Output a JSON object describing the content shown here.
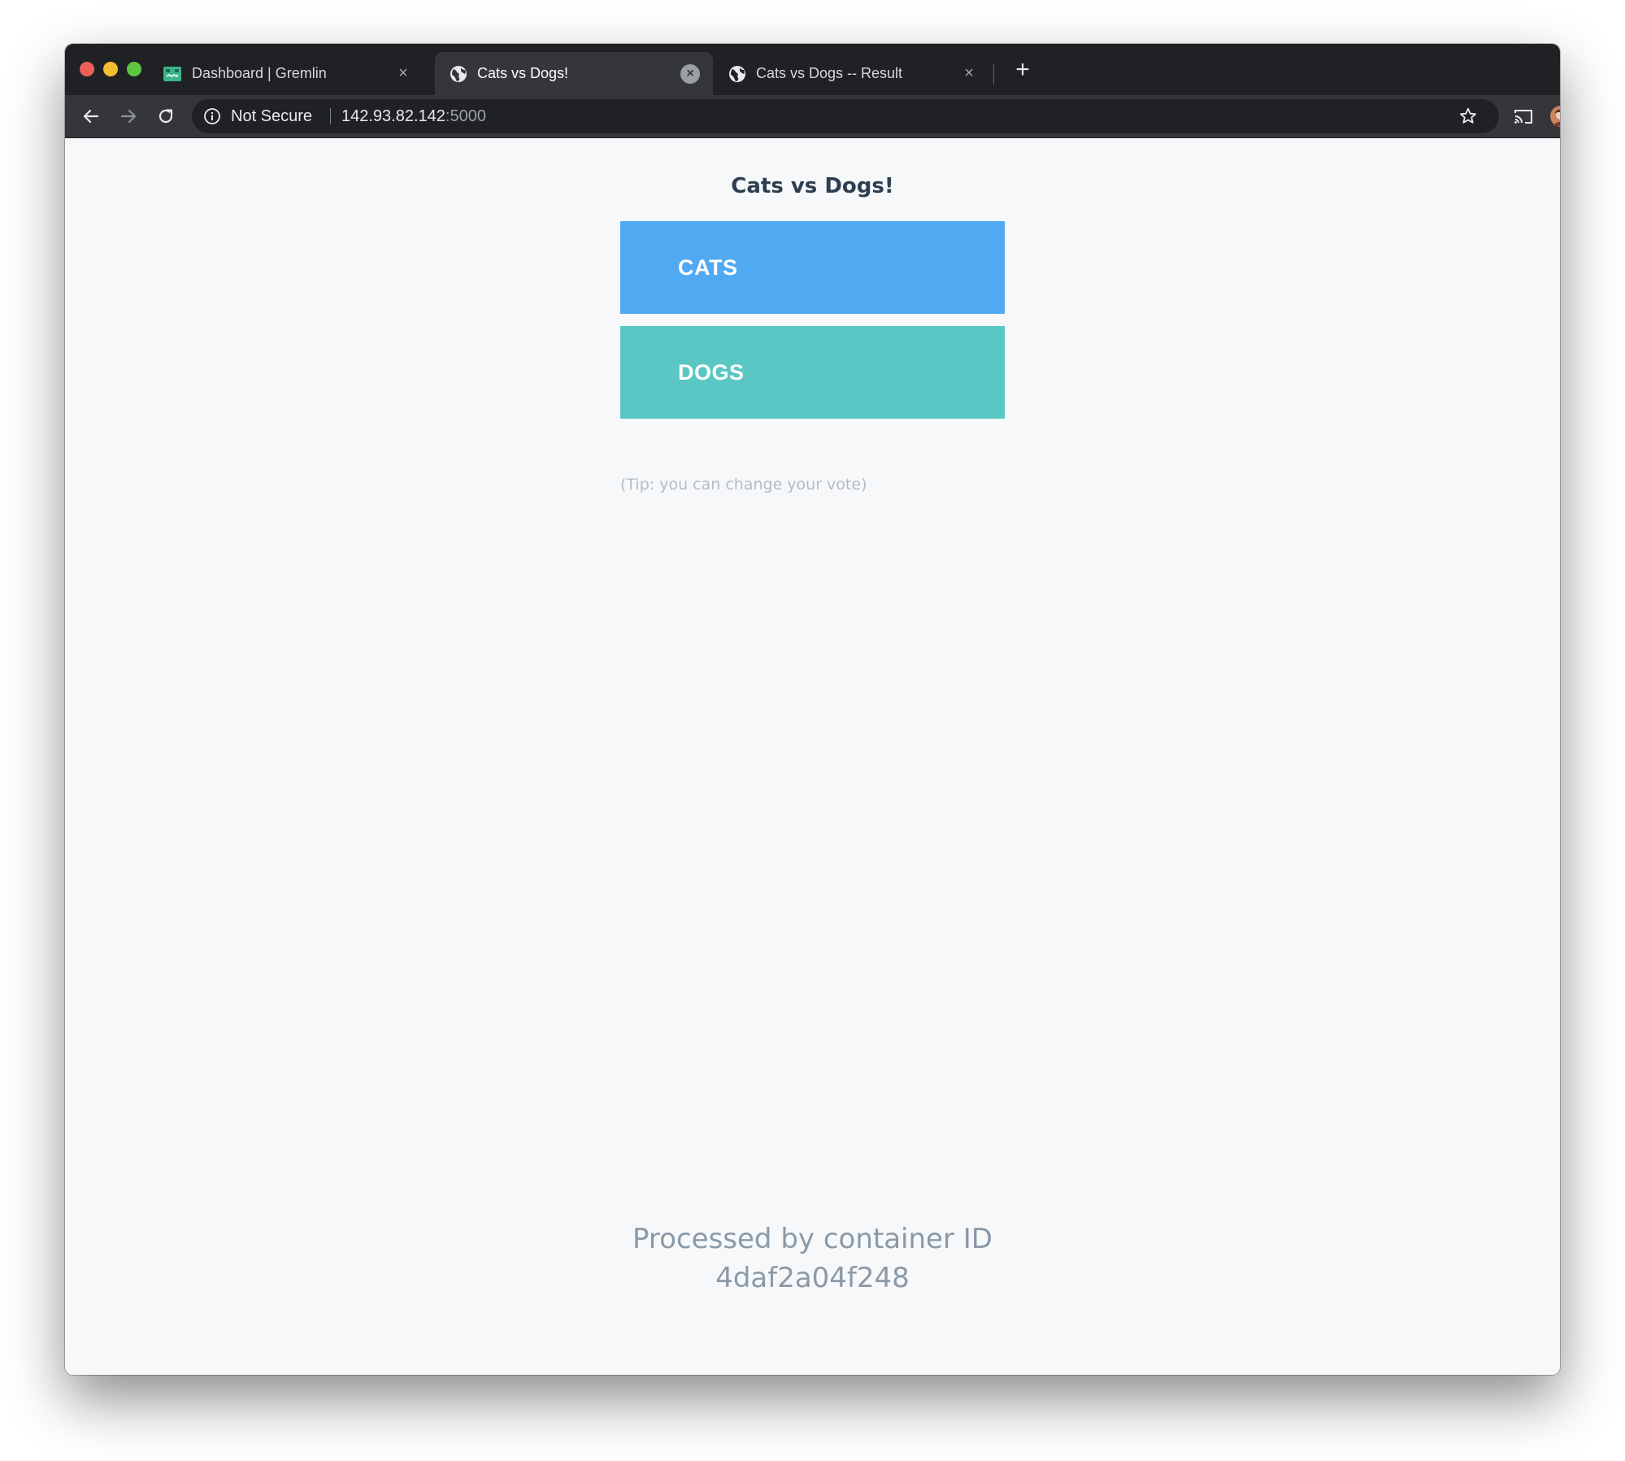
{
  "browser": {
    "tabs": [
      {
        "title": "Dashboard | Gremlin",
        "icon": "gremlin-favicon-icon",
        "active": false
      },
      {
        "title": "Cats vs Dogs!",
        "icon": "globe-icon",
        "active": true
      },
      {
        "title": "Cats vs Dogs -- Result",
        "icon": "globe-icon",
        "active": false
      }
    ],
    "new_tab_label": "+",
    "close_glyph": "×",
    "address_bar": {
      "security_label": "Not Secure",
      "host": "142.93.82.142",
      "port": ":5000"
    }
  },
  "page": {
    "title": "Cats vs Dogs!",
    "options": [
      {
        "label": "CATS",
        "color": "#50a9f1"
      },
      {
        "label": "DOGS",
        "color": "#5bc7c5"
      }
    ],
    "tip": "(Tip: you can change your vote)",
    "footer": {
      "line1": "Processed by container ID",
      "line2": "4daf2a04f248"
    }
  },
  "colors": {
    "titlebar": "#1f2124",
    "toolbar": "#35363a",
    "page_background": "#f6f8fa",
    "heading": "#2c3e50"
  }
}
